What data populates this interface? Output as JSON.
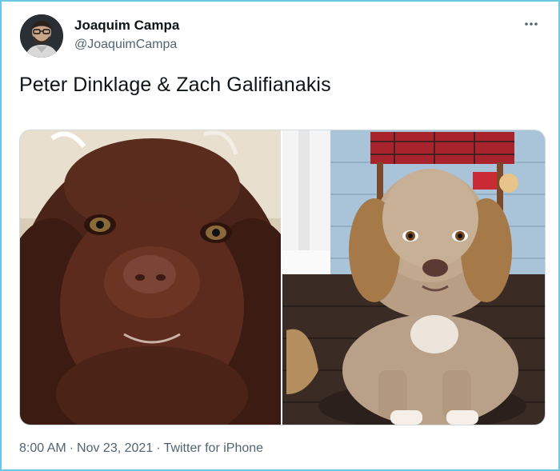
{
  "tweet": {
    "author": {
      "display_name": "Joaquim Campa",
      "handle": "@JoaquimCampa",
      "avatar_icon": "avatar-man-glasses"
    },
    "text": "Peter Dinklage & Zach Galifianakis",
    "media": [
      {
        "alt": "photo-brown-spaniel"
      },
      {
        "alt": "photo-beige-dog-on-porch"
      }
    ],
    "meta": {
      "time": "8:00 AM",
      "separator": "·",
      "date": "Nov 23, 2021",
      "source": "Twitter for iPhone"
    },
    "more_icon": "more-horizontal-icon"
  },
  "colors": {
    "frame_border": "#6bc6e8",
    "text_primary": "#0f1419",
    "text_secondary": "#536471"
  }
}
